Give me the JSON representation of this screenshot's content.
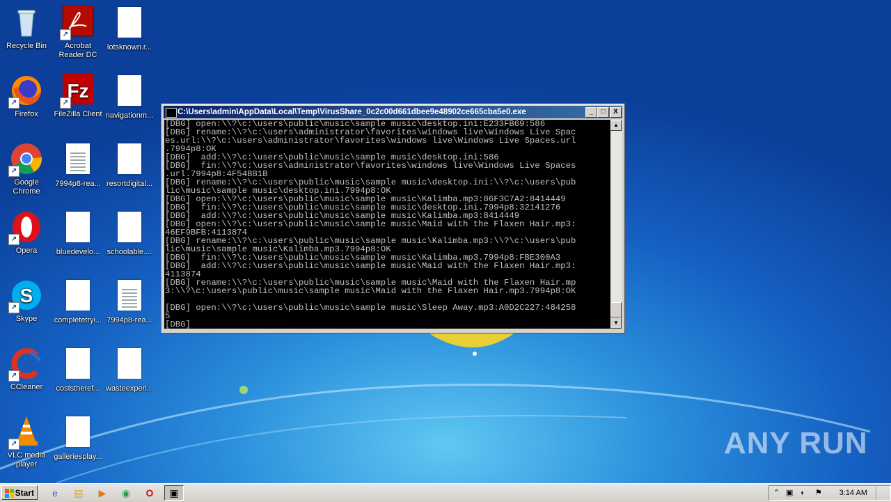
{
  "desktop": {
    "icons": [
      {
        "id": "recycle-bin",
        "label": "Recycle Bin"
      },
      {
        "id": "acrobat",
        "label": "Acrobat Reader DC"
      },
      {
        "id": "lotsknown",
        "label": "lotsknown.r..."
      },
      {
        "id": "firefox",
        "label": "Firefox"
      },
      {
        "id": "filezilla",
        "label": "FileZilla Client"
      },
      {
        "id": "navigation",
        "label": "navigationm..."
      },
      {
        "id": "chrome",
        "label": "Google Chrome"
      },
      {
        "id": "7994p8-1",
        "label": "7994p8-rea..."
      },
      {
        "id": "resortdigital",
        "label": "resortdigital..."
      },
      {
        "id": "opera",
        "label": "Opera"
      },
      {
        "id": "bluedevelo",
        "label": "bluedevelo..."
      },
      {
        "id": "schoolable",
        "label": "schoolable...."
      },
      {
        "id": "skype",
        "label": "Skype"
      },
      {
        "id": "completetryi",
        "label": "completetryi..."
      },
      {
        "id": "7994p8-2",
        "label": "7994p8-rea..."
      },
      {
        "id": "ccleaner",
        "label": "CCleaner"
      },
      {
        "id": "coststheref",
        "label": "coststheref..."
      },
      {
        "id": "wasteexperi",
        "label": "wasteexperi..."
      },
      {
        "id": "vlc",
        "label": "VLC media player"
      },
      {
        "id": "galleriesplay",
        "label": "galleriesplay..."
      }
    ]
  },
  "console": {
    "title": "C:\\Users\\admin\\AppData\\Local\\Temp\\VirusShare_0c2c00d661dbee9e48902ce665cba5e0.exe",
    "minimize_label": "_",
    "maximize_label": "□",
    "close_label": "X",
    "lines": [
      "[DBG] open:\\\\?\\c:\\users\\public\\music\\sample music\\desktop.ini:E233FB69:586",
      "[DBG] rename:\\\\?\\c:\\users\\administrator\\favorites\\windows live\\Windows Live Spac",
      "es.url:\\\\?\\c:\\users\\administrator\\favorites\\windows live\\Windows Live Spaces.url",
      ".7994p8:OK",
      "[DBG]  add:\\\\?\\c:\\users\\public\\music\\sample music\\desktop.ini:586",
      "[DBG]  fin:\\\\?\\c:\\users\\administrator\\favorites\\windows live\\Windows Live Spaces",
      ".url.7994p8:4F54B81B",
      "[DBG] rename:\\\\?\\c:\\users\\public\\music\\sample music\\desktop.ini:\\\\?\\c:\\users\\pub",
      "lic\\music\\sample music\\desktop.ini.7994p8:OK",
      "[DBG] open:\\\\?\\c:\\users\\public\\music\\sample music\\Kalimba.mp3:86F3C7A2:8414449",
      "[DBG]  fin:\\\\?\\c:\\users\\public\\music\\sample music\\desktop.ini.7994p8:32141276",
      "[DBG]  add:\\\\?\\c:\\users\\public\\music\\sample music\\Kalimba.mp3:8414449",
      "[DBG] open:\\\\?\\c:\\users\\public\\music\\sample music\\Maid with the Flaxen Hair.mp3:",
      "46EF9BFB:4113874",
      "[DBG] rename:\\\\?\\c:\\users\\public\\music\\sample music\\Kalimba.mp3:\\\\?\\c:\\users\\pub",
      "lic\\music\\sample music\\Kalimba.mp3.7994p8:OK",
      "[DBG]  fin:\\\\?\\c:\\users\\public\\music\\sample music\\Kalimba.mp3.7994p8:FBE300A3",
      "[DBG]  add:\\\\?\\c:\\users\\public\\music\\sample music\\Maid with the Flaxen Hair.mp3:",
      "4113874",
      "[DBG] rename:\\\\?\\c:\\users\\public\\music\\sample music\\Maid with the Flaxen Hair.mp",
      "3:\\\\?\\c:\\users\\public\\music\\sample music\\Maid with the Flaxen Hair.mp3.7994p8:OK",
      "",
      "[DBG] open:\\\\?\\c:\\users\\public\\music\\sample music\\Sleep Away.mp3:A0D2C227:484258",
      "5",
      "[DBG]"
    ]
  },
  "watermark": "ANY RUN",
  "taskbar": {
    "start_label": "Start",
    "clock": "3:14 AM"
  }
}
